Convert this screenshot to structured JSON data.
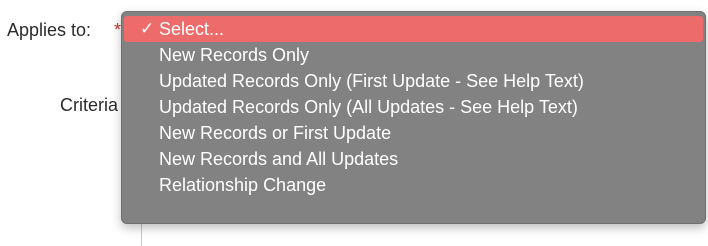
{
  "form": {
    "applies_label": "Applies to:",
    "required_marker": "*",
    "criteria_label": "Criteria"
  },
  "dropdown": {
    "check_icon": "✓",
    "selected_index": 0,
    "options": [
      {
        "label": "Select..."
      },
      {
        "label": "New Records Only"
      },
      {
        "label": "Updated Records Only (First Update - See Help Text)"
      },
      {
        "label": "Updated Records Only (All Updates - See Help Text)"
      },
      {
        "label": "New Records or First Update"
      },
      {
        "label": "New Records and All Updates"
      },
      {
        "label": "Relationship Change"
      }
    ],
    "colors": {
      "menu_background": "#828282",
      "selected_background": "#ed6b6b",
      "option_text": "#ffffff",
      "required_marker": "#c23934"
    }
  }
}
